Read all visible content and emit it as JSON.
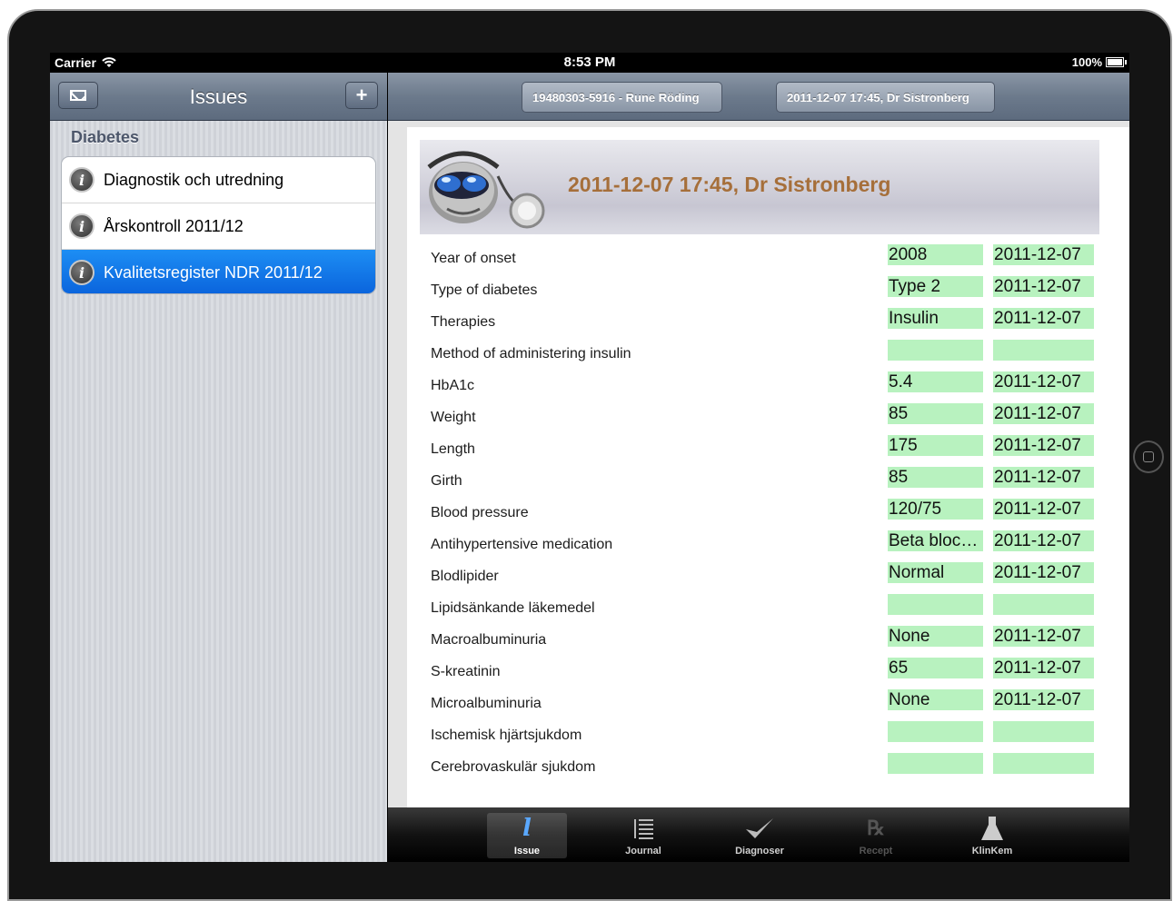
{
  "status_bar": {
    "carrier": "Carrier",
    "time": "8:53 PM",
    "battery": "100%"
  },
  "master": {
    "title": "Issues",
    "add_label": "+",
    "section": "Diabetes",
    "items": [
      {
        "label": "Diagnostik och utredning",
        "icon": "issue-icon",
        "selected": false
      },
      {
        "label": "Årskontroll 2011/12",
        "icon": "issue-icon",
        "selected": false
      },
      {
        "label": "Kvalitetsregister NDR 2011/12",
        "icon": "issue-icon",
        "selected": true
      }
    ]
  },
  "detail": {
    "breadcrumbs": {
      "patient": "19480303-5916 - Rune Röding",
      "visit": "2011-12-07 17:45, Dr Sistronberg"
    },
    "heading": "2011-12-07 17:45, Dr Sistronberg",
    "field_color": "#b8f2bf",
    "heading_color": "#a66f3a",
    "rows": [
      {
        "name": "Year of onset",
        "value": "2008",
        "date": "2011-12-07"
      },
      {
        "name": "Type of diabetes",
        "value": "Type 2",
        "date": "2011-12-07"
      },
      {
        "name": "Therapies",
        "value": "Insulin",
        "date": "2011-12-07"
      },
      {
        "name": "Method of administering insulin",
        "value": "",
        "date": ""
      },
      {
        "name": "HbA1c",
        "value": "5.4",
        "date": "2011-12-07"
      },
      {
        "name": "Weight",
        "value": "85",
        "date": "2011-12-07"
      },
      {
        "name": "Length",
        "value": "175",
        "date": "2011-12-07"
      },
      {
        "name": "Girth",
        "value": "85",
        "date": "2011-12-07"
      },
      {
        "name": "Blood pressure",
        "value": "120/75",
        "date": "2011-12-07"
      },
      {
        "name": "Antihypertensive medication",
        "value": "Beta bloc…",
        "date": "2011-12-07"
      },
      {
        "name": "Blodlipider",
        "value": "Normal",
        "date": "2011-12-07"
      },
      {
        "name": "Lipidsänkande läkemedel",
        "value": "",
        "date": ""
      },
      {
        "name": "Macroalbuminuria",
        "value": "None",
        "date": "2011-12-07"
      },
      {
        "name": "S-kreatinin",
        "value": "65",
        "date": "2011-12-07"
      },
      {
        "name": "Microalbuminuria",
        "value": "None",
        "date": "2011-12-07"
      },
      {
        "name": "Ischemisk hjärtsjukdom",
        "value": "",
        "date": ""
      },
      {
        "name": "Cerebrovaskulär sjukdom",
        "value": "",
        "date": ""
      }
    ]
  },
  "tabbar": {
    "tabs": [
      {
        "label": "Issue",
        "icon": "issue-icon",
        "active": true,
        "disabled": false
      },
      {
        "label": "Journal",
        "icon": "journal-icon",
        "active": false,
        "disabled": false
      },
      {
        "label": "Diagnoser",
        "icon": "checkmark-icon",
        "active": false,
        "disabled": false
      },
      {
        "label": "Recept",
        "icon": "rx-icon",
        "active": false,
        "disabled": true
      },
      {
        "label": "KlinKem",
        "icon": "flask-icon",
        "active": false,
        "disabled": false
      }
    ]
  }
}
